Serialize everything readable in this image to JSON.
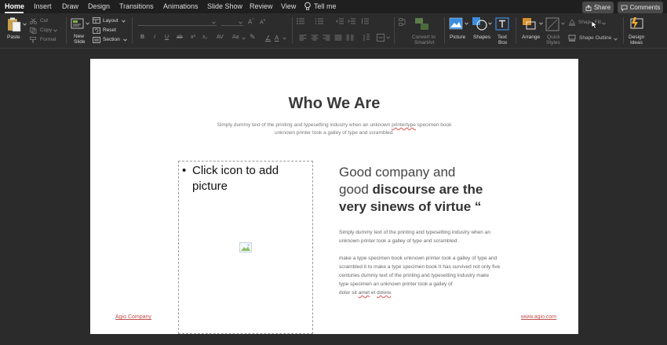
{
  "tabs": [
    "Home",
    "Insert",
    "Draw",
    "Design",
    "Transitions",
    "Animations",
    "Slide Show",
    "Review",
    "View"
  ],
  "tell_me": "Tell me",
  "share_label": "Share",
  "comments_label": "Comments",
  "ribbon": {
    "paste": "Paste",
    "cut": "Cut",
    "copy": "Copy",
    "format": "Format",
    "new_slide_1": "New",
    "new_slide_2": "Slide",
    "layout": "Layout",
    "reset": "Reset",
    "section": "Section",
    "convert_1": "Convert to",
    "convert_2": "SmartArt",
    "picture": "Picture",
    "shapes": "Shapes",
    "textbox_1": "Text",
    "textbox_2": "Box",
    "arrange": "Arrange",
    "quick_styles_1": "Quick",
    "quick_styles_2": "Styles",
    "shape_fill": "Shape Fill",
    "shape_outline": "Shape Outline",
    "design_ideas_1": "Design",
    "design_ideas_2": "Ideas"
  },
  "slide": {
    "title": "Who We Are",
    "subtitle_a": "Simply dummy text of the printing and typesetting industry when an unknown ",
    "subtitle_typo": "printertype",
    "subtitle_b": " specimen book",
    "subtitle_line2": "unknown printer took a galley of type and scrambled.",
    "placeholder_text": "Click icon to add picture",
    "headline_line1": "Good company and",
    "headline_line2_a": "good ",
    "headline_line2_b": "discourse are the",
    "headline_line3": "very sinews of virtue “",
    "para1_line1": "Simply dummy text of the printing and typesetting industry when an",
    "para1_line2": "unknown printer took a galley of type and scrambled .",
    "para2_line1": "make a type specimen book unknown printer took a galley of type and",
    "para2_line2": "scrambled it to make a type specimen book It has survived not only five",
    "para2_line3": "centuries dummy text of the printing and typesetting industry make",
    "para2_line4": "type specimen an unknown printer took a galley of",
    "para2_line5_a": "dolor sit ",
    "para2_amet": "amet",
    "para2_line5_b": " et ",
    "para2_dolore": "dolore",
    "para2_line5_c": ".",
    "footer_left": "Agio Company",
    "footer_right": "www.agio.com"
  },
  "colors": {
    "app_bg": "#2b2b2b",
    "tabbar_bg": "#1f1f1f",
    "accent_blue": "#3c8dde",
    "link_red": "#c0504d"
  }
}
